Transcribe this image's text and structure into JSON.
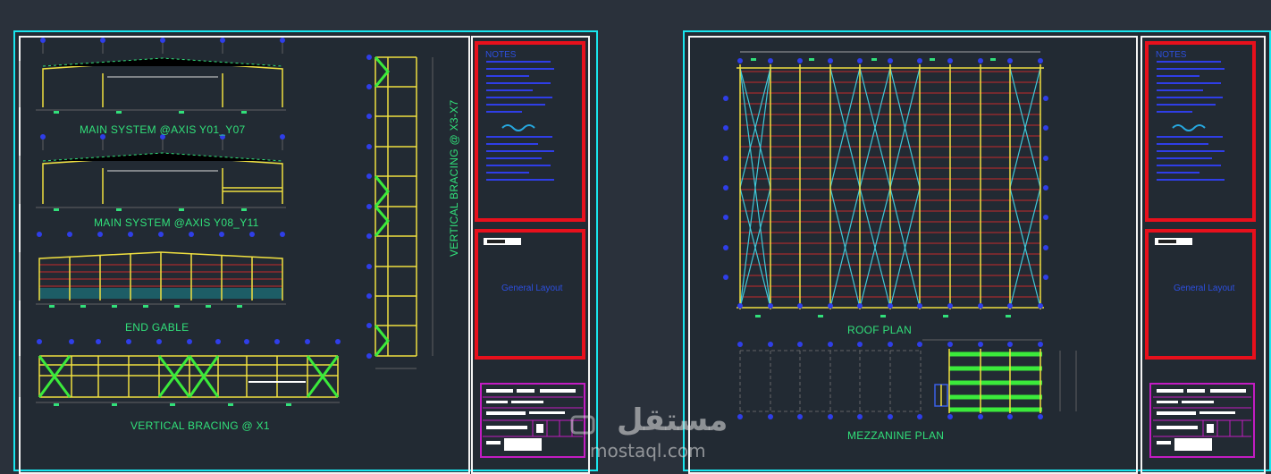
{
  "sheet1": {
    "labels": {
      "main_system_1": "MAIN SYSTEM @AXIS Y01_Y07",
      "main_system_2": "MAIN SYSTEM @AXIS Y08_Y11",
      "end_gable": "END GABLE",
      "vertical_bracing_x1": "VERTICAL BRACING @ X1",
      "vertical_bracing_x3x7": "VERTICAL BRACING @ X3-X7"
    },
    "title_block": {
      "notes_heading": "NOTES",
      "sheet_subtitle": "General Layout"
    }
  },
  "sheet2": {
    "labels": {
      "roof_plan": "ROOF PLAN",
      "mezzanine_plan": "MEZZANINE PLAN"
    },
    "title_block": {
      "notes_heading": "NOTES",
      "sheet_subtitle": "General Layout"
    }
  },
  "watermark": {
    "arabic": "مستقل",
    "latin": "mostaql.com"
  },
  "colors": {
    "background": "#2a313b",
    "sheet_border": "#19e6ee",
    "label": "#31e07a",
    "steel": "#f0e040",
    "bracing": "#3bea3b",
    "roof_bracing": "#3fc8d8",
    "purlin": "#c62b2b",
    "title_block": "#e8101c",
    "text_blue": "#2d4fe0"
  }
}
